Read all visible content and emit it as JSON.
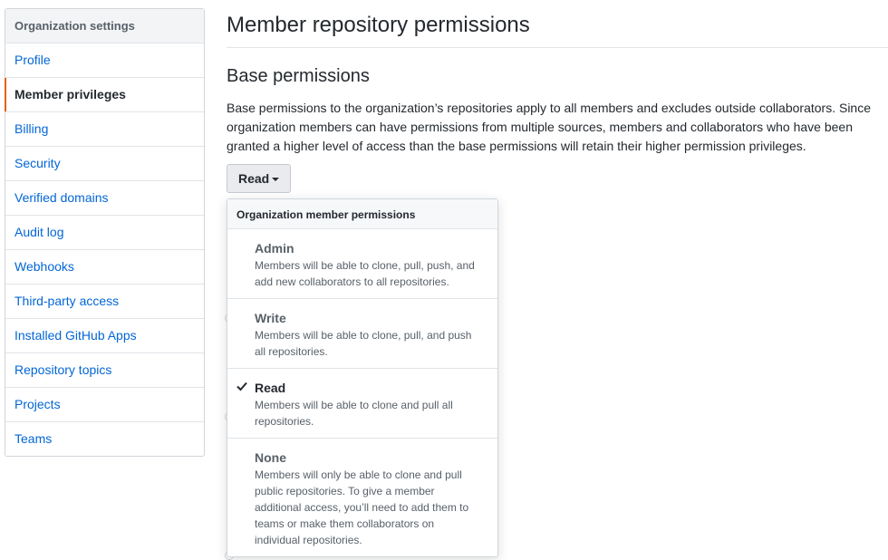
{
  "sidebar": {
    "header": "Organization settings",
    "items": [
      {
        "label": "Profile"
      },
      {
        "label": "Member privileges"
      },
      {
        "label": "Billing"
      },
      {
        "label": "Security"
      },
      {
        "label": "Verified domains"
      },
      {
        "label": "Audit log"
      },
      {
        "label": "Webhooks"
      },
      {
        "label": "Third-party access"
      },
      {
        "label": "Installed GitHub Apps"
      },
      {
        "label": "Repository topics"
      },
      {
        "label": "Projects"
      },
      {
        "label": "Teams"
      }
    ]
  },
  "main": {
    "title": "Member repository permissions",
    "section_title": "Base permissions",
    "description": "Base permissions to the organization’s repositories apply to all members and excludes outside collaborators. Since organization members can have permissions from multiple sources, members and collaborators who have been granted a higher level of access than the base permissions will retain their higher permission privileges.",
    "dropdown_value": "Read"
  },
  "menu": {
    "header": "Organization member permissions",
    "options": [
      {
        "title": "Admin",
        "desc": "Members will be able to clone, pull, push, and add new collaborators to all repositories."
      },
      {
        "title": "Write",
        "desc": "Members will be able to clone, pull, and push all repositories."
      },
      {
        "title": "Read",
        "desc": "Members will be able to clone and pull all repositories."
      },
      {
        "title": "None",
        "desc": "Members will only be able to clone and pull public repositories. To give a member additional access, you’ll need to add them to teams or make them collaborators on individual repositories."
      }
    ],
    "selected": "Read"
  },
  "colors": {
    "accent": "#e36209",
    "link": "#0366d6"
  }
}
